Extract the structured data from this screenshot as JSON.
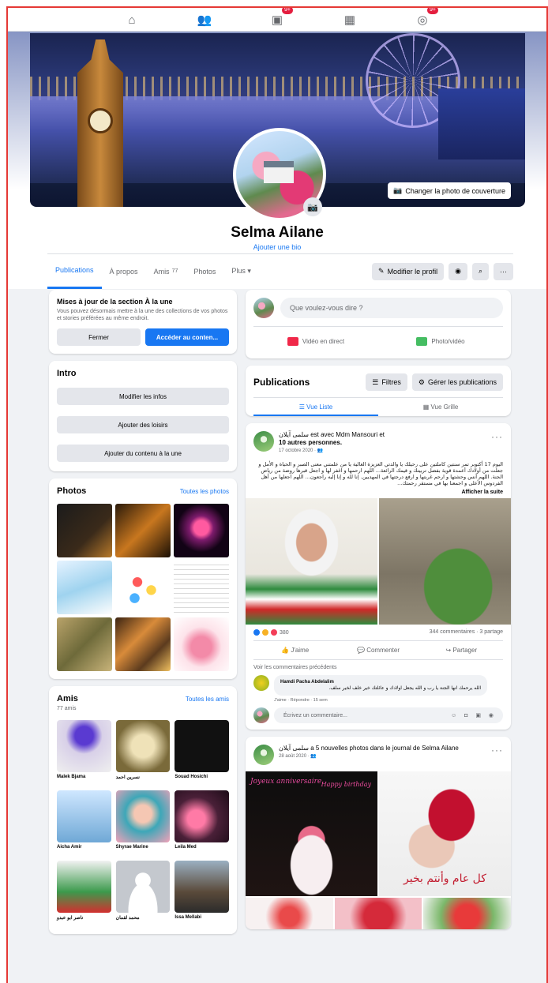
{
  "cover": {
    "change_label": "Changer la photo de couverture"
  },
  "profile": {
    "name": "Selma Ailane",
    "bio_link": "Ajouter une bio"
  },
  "tabs": [
    {
      "label": "Publications"
    },
    {
      "label": "À propos"
    },
    {
      "label": "Amis",
      "count": "77"
    },
    {
      "label": "Photos"
    },
    {
      "label": "Plus ▾"
    }
  ],
  "actions": {
    "edit_profile": "Modifier le profil"
  },
  "highlights": {
    "title": "Mises à jour de la section À la une",
    "desc": "Vous pouvez désormais mettre à la une des collections de vos photos et stories préférées au même endroit.",
    "close": "Fermer",
    "access": "Accéder au conten..."
  },
  "intro": {
    "title": "Intro",
    "edit": "Modifier les infos",
    "hobbies": "Ajouter des loisirs",
    "featured": "Ajouter du contenu à la une"
  },
  "photos": {
    "title": "Photos",
    "all": "Toutes les photos"
  },
  "friends": {
    "title": "Amis",
    "all": "Toutes les amis",
    "count": "77 amis",
    "list": [
      {
        "name": "Malek Bjama"
      },
      {
        "name": "نسرين احمد"
      },
      {
        "name": "Souad Hosichi"
      },
      {
        "name": "Aicha Amir"
      },
      {
        "name": "Shyrae Marine"
      },
      {
        "name": "Leila Med"
      },
      {
        "name": "ناصر ابو عبدو"
      },
      {
        "name": "محمد لقمان"
      },
      {
        "name": "Issa Mellabi"
      }
    ]
  },
  "composer": {
    "placeholder": "Que voulez-vous dire ?",
    "live": "Vidéo en direct",
    "photo": "Photo/vidéo"
  },
  "pubs": {
    "title": "Publications",
    "filter": "Filtres",
    "manage": "Gérer les publications",
    "list_view": "Vue Liste",
    "grid_view": "Vue Grille"
  },
  "post1": {
    "author_line": "سلمى آيلان est avec Mdm Mansouri et",
    "others": "10 autres personnes.",
    "date": "17 octobre 2020 · ",
    "text": "اليوم 17 أكتوبر تمر سنتين كاملتين على رحيلك يا والدتي العزيزة الغالية يا من علمتني معنى الصبر و الحياة و الأمل و جعلت من أولادك أعمدة قوية بفضل تربيتك و قيمك الرائعة... اللهم ارحمها و اغفر لها و اجعل قبرها روضة من رياض الجنة. اللهم آنس وحشتها و ارحم غربتها و ارفع درجتها في المهديين. إنا لله و إنا إليه راجعون... اللهم اجعلها من أهل الفردوس الأعلى و اجمعنا بها في مستقر رحمتك...",
    "see_more": "Afficher la suite",
    "reactions": "380",
    "stats": "344 commentaires · 3 partage",
    "like": "J'aime",
    "comment": "Commenter",
    "share": "Partager",
    "prev_comments": "Voir les commentaires précédents",
    "commenter": "Hamdi Pacha Abdelalim",
    "comment_text": "الله يرحمك انها الجنة يا رب و الله يجعل اولادك و عائلتك خير خلف لخير سلف.",
    "comment_links": "J'aime · Répondre · 15 sem",
    "write_placeholder": "Écrivez un commentaire..."
  },
  "post2": {
    "author_line": "سلمى آيلان a 5 nouvelles photos dans le journal de Selma Ailane",
    "date": "28 août 2020 · ",
    "img_text1": "Joyeux anniversaire",
    "img_text2": "Happy birthday",
    "img_text3": "كل عام وأنتم بخير"
  },
  "icons": [
    "home-icon",
    "friends-icon",
    "watch-icon",
    "marketplace-icon",
    "groups-icon",
    "camera-icon",
    "eye-icon",
    "search-icon",
    "more-icon",
    "pencil-icon",
    "filter-icon",
    "gear-icon",
    "list-icon",
    "grid-icon"
  ],
  "colors": {
    "accent": "#1877f2",
    "bg": "#f0f2f5",
    "frame_border": "#e53935",
    "badge": "#e41e3f"
  }
}
